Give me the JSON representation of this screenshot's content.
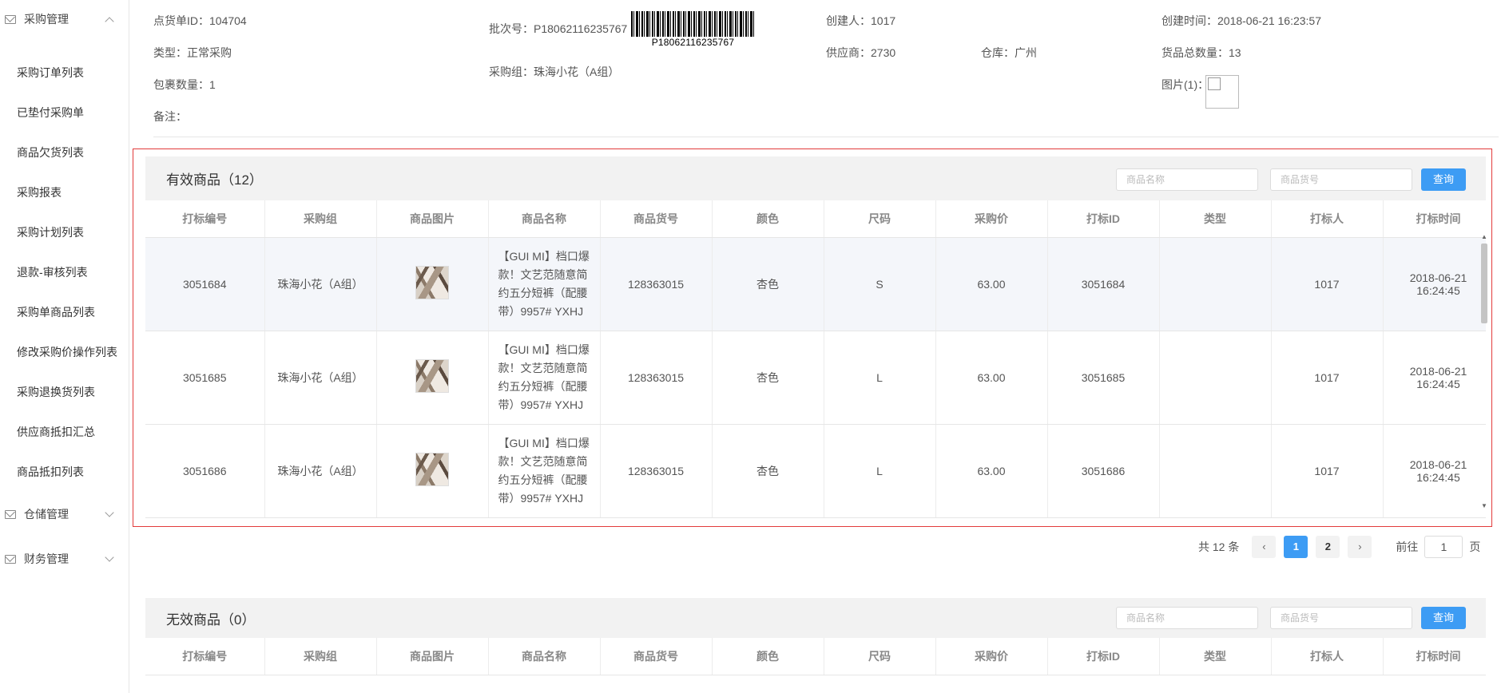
{
  "sidebar": {
    "groups": [
      {
        "label": "采购管理",
        "expanded": true
      },
      {
        "label": "仓储管理",
        "expanded": false
      },
      {
        "label": "财务管理",
        "expanded": false
      }
    ],
    "items": [
      "采购订单列表",
      "已垫付采购单",
      "商品欠货列表",
      "采购报表",
      "采购计划列表",
      "退款-审核列表",
      "采购单商品列表",
      "修改采购价操作列表",
      "采购退换货列表",
      "供应商抵扣汇总",
      "商品抵扣列表"
    ]
  },
  "info": {
    "check_id_label": "点货单ID：",
    "check_id": "104704",
    "batch_label": "批次号：",
    "batch": "P18062116235767",
    "barcode_text": "P18062116235767",
    "creator_label": "创建人：",
    "creator": "1017",
    "created_label": "创建时间：",
    "created": "2018-06-21 16:23:57",
    "type_label": "类型：",
    "type": "正常采购",
    "supplier_label": "供应商：",
    "supplier": "2730",
    "warehouse_label": "仓库：",
    "warehouse": "广州",
    "total_label": "货品总数量：",
    "total": "13",
    "package_label": "包裹数量：",
    "package": "1",
    "group_label": "采购组：",
    "group": "珠海小花（A组）",
    "image_label": "图片(1)：",
    "remark_label": "备注："
  },
  "valid": {
    "title": "有效商品（12）",
    "search_name_placeholder": "商品名称",
    "search_code_placeholder": "商品货号",
    "query_label": "查询",
    "columns": [
      "打标编号",
      "采购组",
      "商品图片",
      "商品名称",
      "商品货号",
      "颜色",
      "尺码",
      "采购价",
      "打标ID",
      "类型",
      "打标人",
      "打标时间"
    ],
    "rows": [
      {
        "mark_no": "3051684",
        "group": "珠海小花（A组）",
        "name": "【GUI MI】档口爆款！文艺范随意简约五分短裤（配腰带）9957# YXHJ",
        "code": "128363015",
        "color": "杏色",
        "size": "S",
        "price": "63.00",
        "mark_id": "3051684",
        "type": "",
        "marker": "1017",
        "time": "2018-06-21 16:24:45"
      },
      {
        "mark_no": "3051685",
        "group": "珠海小花（A组）",
        "name": "【GUI MI】档口爆款！文艺范随意简约五分短裤（配腰带）9957# YXHJ",
        "code": "128363015",
        "color": "杏色",
        "size": "L",
        "price": "63.00",
        "mark_id": "3051685",
        "type": "",
        "marker": "1017",
        "time": "2018-06-21 16:24:45"
      },
      {
        "mark_no": "3051686",
        "group": "珠海小花（A组）",
        "name": "【GUI MI】档口爆款！文艺范随意简约五分短裤（配腰带）9957# YXHJ",
        "code": "128363015",
        "color": "杏色",
        "size": "L",
        "price": "63.00",
        "mark_id": "3051686",
        "type": "",
        "marker": "1017",
        "time": "2018-06-21 16:24:45"
      }
    ]
  },
  "pager": {
    "total": "共 12 条",
    "prev": "‹",
    "pages": [
      "1",
      "2"
    ],
    "next": "›",
    "goto_label": "前往",
    "goto_value": "1",
    "page_suffix": "页"
  },
  "invalid": {
    "title": "无效商品（0）",
    "search_name_placeholder": "商品名称",
    "search_code_placeholder": "商品货号",
    "query_label": "查询",
    "columns": [
      "打标编号",
      "采购组",
      "商品图片",
      "商品名称",
      "商品货号",
      "颜色",
      "尺码",
      "采购价",
      "打标ID",
      "类型",
      "打标人",
      "打标时间"
    ]
  },
  "colors": {
    "accent": "#3d9cf4",
    "highlight_border": "#e23b3b"
  }
}
